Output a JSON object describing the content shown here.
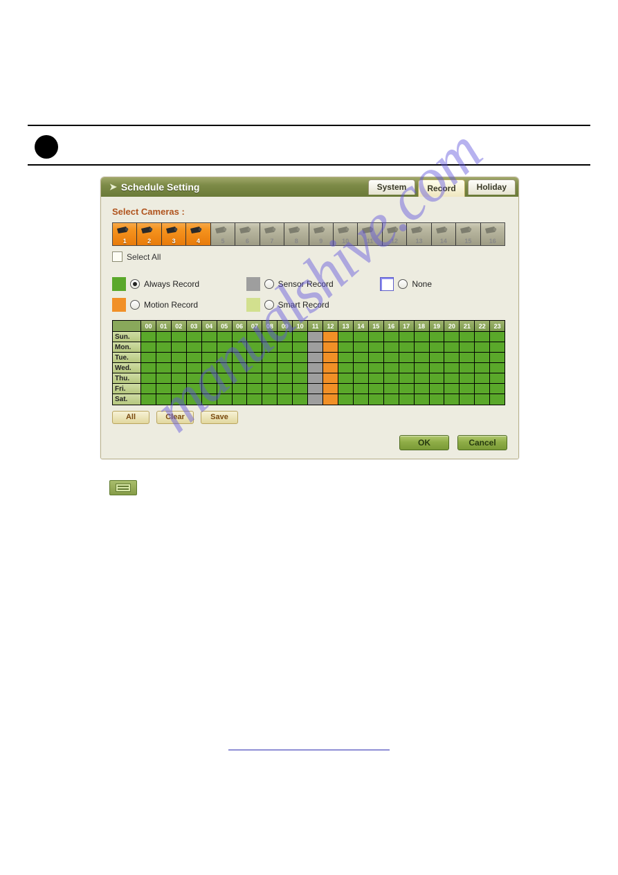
{
  "watermark_text": "manualshive.com",
  "dialog": {
    "title": "Schedule Setting",
    "tabs": {
      "system": "System",
      "record": "Record",
      "holiday": "Holiday",
      "active": "record"
    },
    "select_cameras_label": "Select Cameras :",
    "select_all_label": "Select All",
    "cameras": [
      {
        "n": "1",
        "enabled": true,
        "selected": true
      },
      {
        "n": "2",
        "enabled": true,
        "selected": true
      },
      {
        "n": "3",
        "enabled": true,
        "selected": true
      },
      {
        "n": "4",
        "enabled": true,
        "selected": true
      },
      {
        "n": "5",
        "enabled": false,
        "selected": false
      },
      {
        "n": "6",
        "enabled": false,
        "selected": false
      },
      {
        "n": "7",
        "enabled": false,
        "selected": false
      },
      {
        "n": "8",
        "enabled": false,
        "selected": false
      },
      {
        "n": "9",
        "enabled": false,
        "selected": false
      },
      {
        "n": "10",
        "enabled": false,
        "selected": false
      },
      {
        "n": "11",
        "enabled": false,
        "selected": false
      },
      {
        "n": "12",
        "enabled": false,
        "selected": false
      },
      {
        "n": "13",
        "enabled": false,
        "selected": false
      },
      {
        "n": "14",
        "enabled": false,
        "selected": false
      },
      {
        "n": "15",
        "enabled": false,
        "selected": false
      },
      {
        "n": "16",
        "enabled": false,
        "selected": false
      }
    ],
    "record_modes": {
      "always": "Always Record",
      "motion": "Motion Record",
      "sensor": "Sensor Record",
      "smart": "Smart Record",
      "none": "None",
      "selected": "always"
    },
    "hours": [
      "00",
      "01",
      "02",
      "03",
      "04",
      "05",
      "06",
      "07",
      "08",
      "09",
      "10",
      "11",
      "12",
      "13",
      "14",
      "15",
      "16",
      "17",
      "18",
      "19",
      "20",
      "21",
      "22",
      "23"
    ],
    "days": [
      "Sun.",
      "Mon.",
      "Tue.",
      "Wed.",
      "Thu.",
      "Fri.",
      "Sat."
    ],
    "grid_cell_mode": {
      "default": "a",
      "overrides": {
        "11": "s",
        "12": "m"
      }
    },
    "grid_buttons": {
      "all": "All",
      "clear": "Clear",
      "save": "Save"
    },
    "footer": {
      "ok": "OK",
      "cancel": "Cancel"
    }
  }
}
